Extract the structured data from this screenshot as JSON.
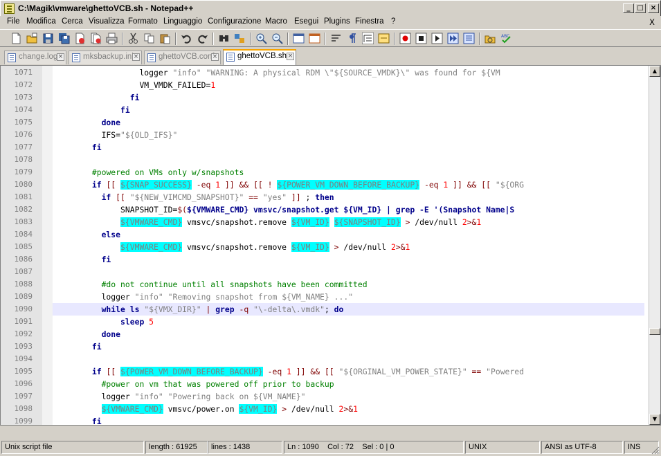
{
  "window": {
    "title": "C:\\Magik\\vmware\\ghettoVCB.sh - Notepad++"
  },
  "menu": [
    "File",
    "Modifica",
    "Cerca",
    "Visualizza",
    "Formato",
    "Linguaggio",
    "Configurazione",
    "Macro",
    "Esegui",
    "Plugins",
    "Finestra",
    "?"
  ],
  "menu_close": "X",
  "tabs": [
    {
      "label": "change.log",
      "active": false
    },
    {
      "label": "mksbackup.ini",
      "active": false
    },
    {
      "label": "ghettoVCB.conf",
      "active": false
    },
    {
      "label": "ghettoVCB.sh",
      "active": true
    }
  ],
  "editor": {
    "current_line": 1090,
    "lines": [
      {
        "n": "1071",
        "html": "                  logger <span class=\"st\">\"info\"</span> <span class=\"st\">\"WARNING: A physical RDM \\\"${SOURCE_VMDK}\\\" was found for ${VM</span>"
      },
      {
        "n": "1072",
        "html": "                  VM_VMDK_FAILED=<span class=\"num\">1</span>"
      },
      {
        "n": "1073",
        "html": "                <span class=\"kw\">fi</span>"
      },
      {
        "n": "1074",
        "html": "              <span class=\"kw\">fi</span>"
      },
      {
        "n": "1075",
        "html": "          <span class=\"kw\">done</span>"
      },
      {
        "n": "1076",
        "html": "          IFS=<span class=\"st\">\"${OLD_IFS}\"</span>"
      },
      {
        "n": "1077",
        "html": "        <span class=\"kw\">fi</span>"
      },
      {
        "n": "1078",
        "html": ""
      },
      {
        "n": "1079",
        "html": "        <span class=\"cm\">#powered on VMs only w/snapshots</span>"
      },
      {
        "n": "1080",
        "html": "        <span class=\"kw\">if</span> <span class=\"op\">[[</span> <span class=\"var\">${SNAP_SUCCESS}</span> <span class=\"op\">-eq</span> <span class=\"num\">1</span> <span class=\"op\">]]</span> <span class=\"op\">&amp;&amp;</span> <span class=\"op\">[[</span> <span class=\"op\">!</span> <span class=\"var\">${POWER_VM_DOWN_BEFORE_BACKUP}</span> <span class=\"op\">-eq</span> <span class=\"num\">1</span> <span class=\"op\">]]</span> <span class=\"op\">&amp;&amp;</span> <span class=\"op\">[[</span> <span class=\"st\">\"${ORG</span>"
      },
      {
        "n": "1081",
        "html": "          <span class=\"kw\">if</span> <span class=\"op\">[[</span> <span class=\"st\">\"${NEW_VIMCMD_SNAPSHOT}\"</span> <span class=\"op\">==</span> <span class=\"st\">\"yes\"</span> <span class=\"op\">]]</span> ; <span class=\"kw\">then</span>"
      },
      {
        "n": "1082",
        "html": "              SNAPSHOT_ID=<span class=\"op\">$(</span><span class=\"kw\">${VMWARE_CMD} vmsvc/snapshot.get ${VM_ID} | grep -E '(Snapshot Name|S</span>"
      },
      {
        "n": "1083",
        "html": "              <span class=\"var\">${VMWARE_CMD}</span> vmsvc/snapshot.remove <span class=\"var\">${VM_ID}</span> <span class=\"var\">${SNAPSHOT_ID}</span> <span class=\"op\">&gt;</span> /dev/null <span class=\"num\">2</span><span class=\"op\">&gt;&amp;</span><span class=\"num\">1</span>"
      },
      {
        "n": "1084",
        "html": "          <span class=\"kw\">else</span>"
      },
      {
        "n": "1085",
        "html": "              <span class=\"var\">${VMWARE_CMD}</span> vmsvc/snapshot.remove <span class=\"var\">${VM_ID}</span> <span class=\"op\">&gt;</span> /dev/null <span class=\"num\">2</span><span class=\"op\">&gt;&amp;</span><span class=\"num\">1</span>"
      },
      {
        "n": "1086",
        "html": "          <span class=\"kw\">fi</span>"
      },
      {
        "n": "1087",
        "html": ""
      },
      {
        "n": "1088",
        "html": "          <span class=\"cm\">#do not continue until all snapshots have been committed</span>"
      },
      {
        "n": "1089",
        "html": "          logger <span class=\"st\">\"info\"</span> <span class=\"st\">\"Removing snapshot from ${VM_NAME} ...\"</span>"
      },
      {
        "n": "1090",
        "html": "          <span class=\"kw\">while</span> <span class=\"kw\">ls</span> <span class=\"st\">\"${VMX_DIR}\"</span> <span class=\"op\">|</span> <span class=\"kw\">grep</span> <span class=\"op\">-q</span> <span class=\"st\">\"\\-delta\\.vmdk\"</span>; <span class=\"kw\">do</span>"
      },
      {
        "n": "1091",
        "html": "              <span class=\"kw\">sleep</span> <span class=\"num\">5</span>"
      },
      {
        "n": "1092",
        "html": "          <span class=\"kw\">done</span>"
      },
      {
        "n": "1093",
        "html": "        <span class=\"kw\">fi</span>"
      },
      {
        "n": "1094",
        "html": ""
      },
      {
        "n": "1095",
        "html": "        <span class=\"kw\">if</span> <span class=\"op\">[[</span> <span class=\"var\">${POWER_VM_DOWN_BEFORE_BACKUP}</span> <span class=\"op\">-eq</span> <span class=\"num\">1</span> <span class=\"op\">]]</span> <span class=\"op\">&amp;&amp;</span> <span class=\"op\">[[</span> <span class=\"st\">\"${ORGINAL_VM_POWER_STATE}\"</span> <span class=\"op\">==</span> <span class=\"st\">\"Powered</span>"
      },
      {
        "n": "1096",
        "html": "          <span class=\"cm\">#power on vm that was powered off prior to backup</span>"
      },
      {
        "n": "1097",
        "html": "          logger <span class=\"st\">\"info\"</span> <span class=\"st\">\"Powering back on ${VM_NAME}\"</span>"
      },
      {
        "n": "1098",
        "html": "          <span class=\"var\">${VMWARE_CMD}</span> vmsvc/power.on <span class=\"var\">${VM_ID}</span> <span class=\"op\">&gt;</span> /dev/null <span class=\"num\">2</span><span class=\"op\">&gt;&amp;</span><span class=\"num\">1</span>"
      },
      {
        "n": "1099",
        "html": "        <span class=\"kw\">fi</span>"
      }
    ]
  },
  "status": {
    "file_type": "Unix script file",
    "length": "length : 61925",
    "lines": "lines : 1438",
    "position": "Ln : 1090    Col : 72    Sel : 0 | 0",
    "eol": "UNIX",
    "encoding": "ANSI as UTF-8",
    "mode": "INS"
  },
  "colors": {
    "keyword": "#00008b",
    "comment": "#008000",
    "string": "#808080",
    "number": "#ff0000",
    "variable_bg": "#00ffff",
    "tab_accent": "#f7a400"
  }
}
